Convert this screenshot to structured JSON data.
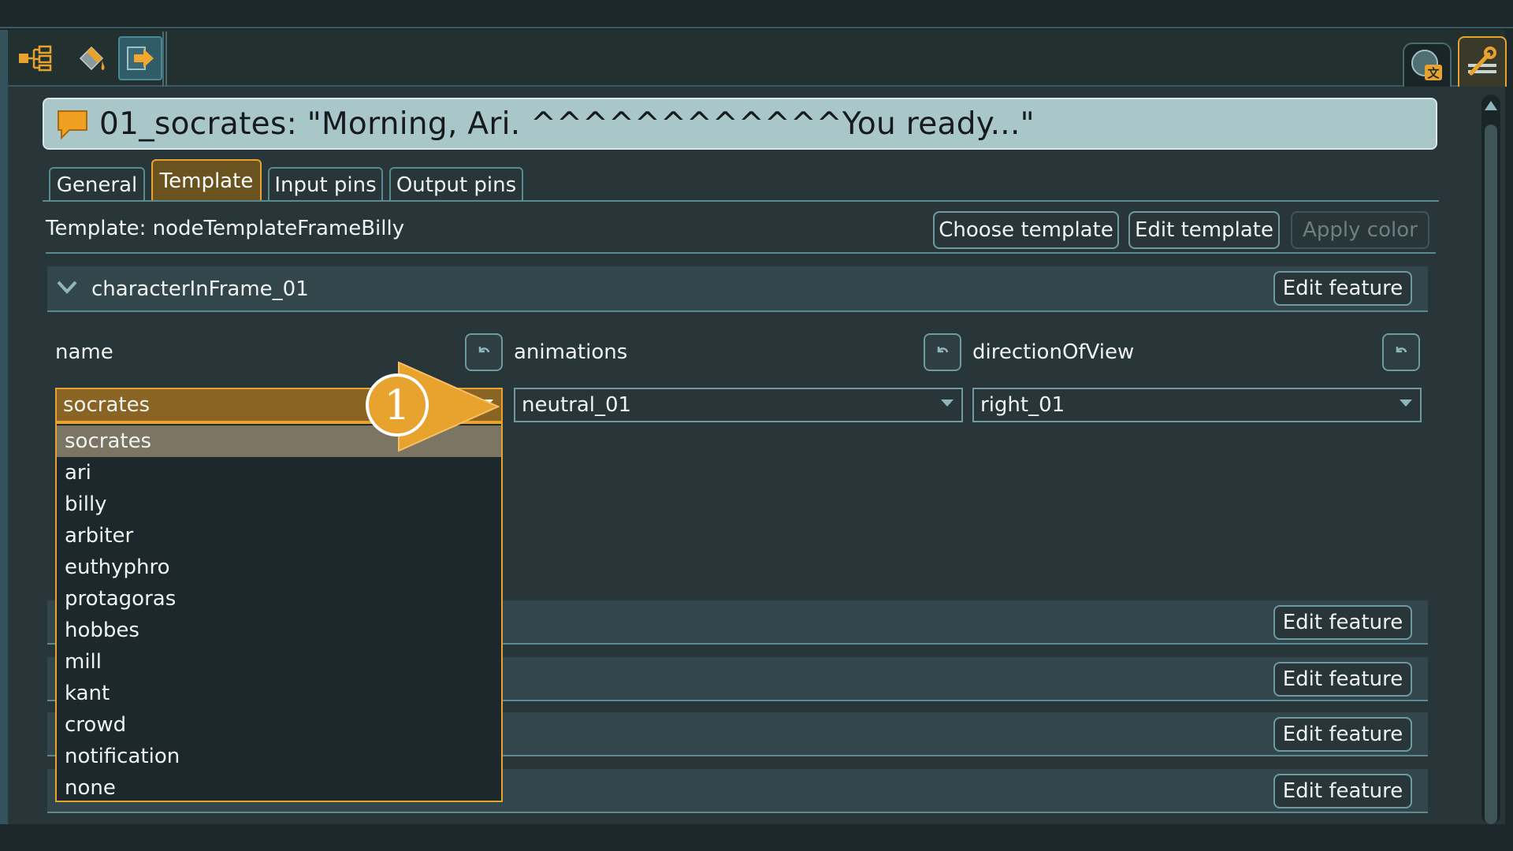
{
  "title": "01_socrates: \"Morning, Ari. ^^^^^^^^^^^^You ready...\"",
  "tabs": [
    {
      "label": "General"
    },
    {
      "label": "Template",
      "active": true
    },
    {
      "label": "Input pins"
    },
    {
      "label": "Output pins"
    }
  ],
  "template": {
    "label": "Template: nodeTemplateFrameBilly",
    "choose_label": "Choose template",
    "edit_label": "Edit template",
    "apply_color_label": "Apply color"
  },
  "feature": {
    "name": "characterInFrame_01",
    "edit_label": "Edit feature"
  },
  "properties": [
    {
      "label": "name",
      "value": "socrates"
    },
    {
      "label": "animations",
      "value": "neutral_01"
    },
    {
      "label": "directionOfView",
      "value": "right_01"
    }
  ],
  "dropdown": {
    "items": [
      "socrates",
      "ari",
      "billy",
      "arbiter",
      "euthyphro",
      "protagoras",
      "hobbes",
      "mill",
      "kant",
      "crowd",
      "notification",
      "none"
    ],
    "selected": "socrates"
  },
  "more_features": [
    {
      "edit_label": "Edit feature"
    },
    {
      "edit_label": "Edit feature"
    },
    {
      "edit_label": "Edit feature"
    },
    {
      "edit_label": "Edit feature"
    }
  ],
  "callout": {
    "number": "1"
  },
  "colors": {
    "accent": "#e8a22e",
    "panel": "#283539",
    "title_bar": "#a9c6c9",
    "border": "#6f9aa0",
    "selected_item": "#7d7563"
  },
  "icons": {
    "toolbar": [
      "node-tree-icon",
      "paint-bucket-icon",
      "export-arrow-icon"
    ],
    "right": [
      "globe-translate-icon",
      "wrench-tools-icon"
    ]
  }
}
